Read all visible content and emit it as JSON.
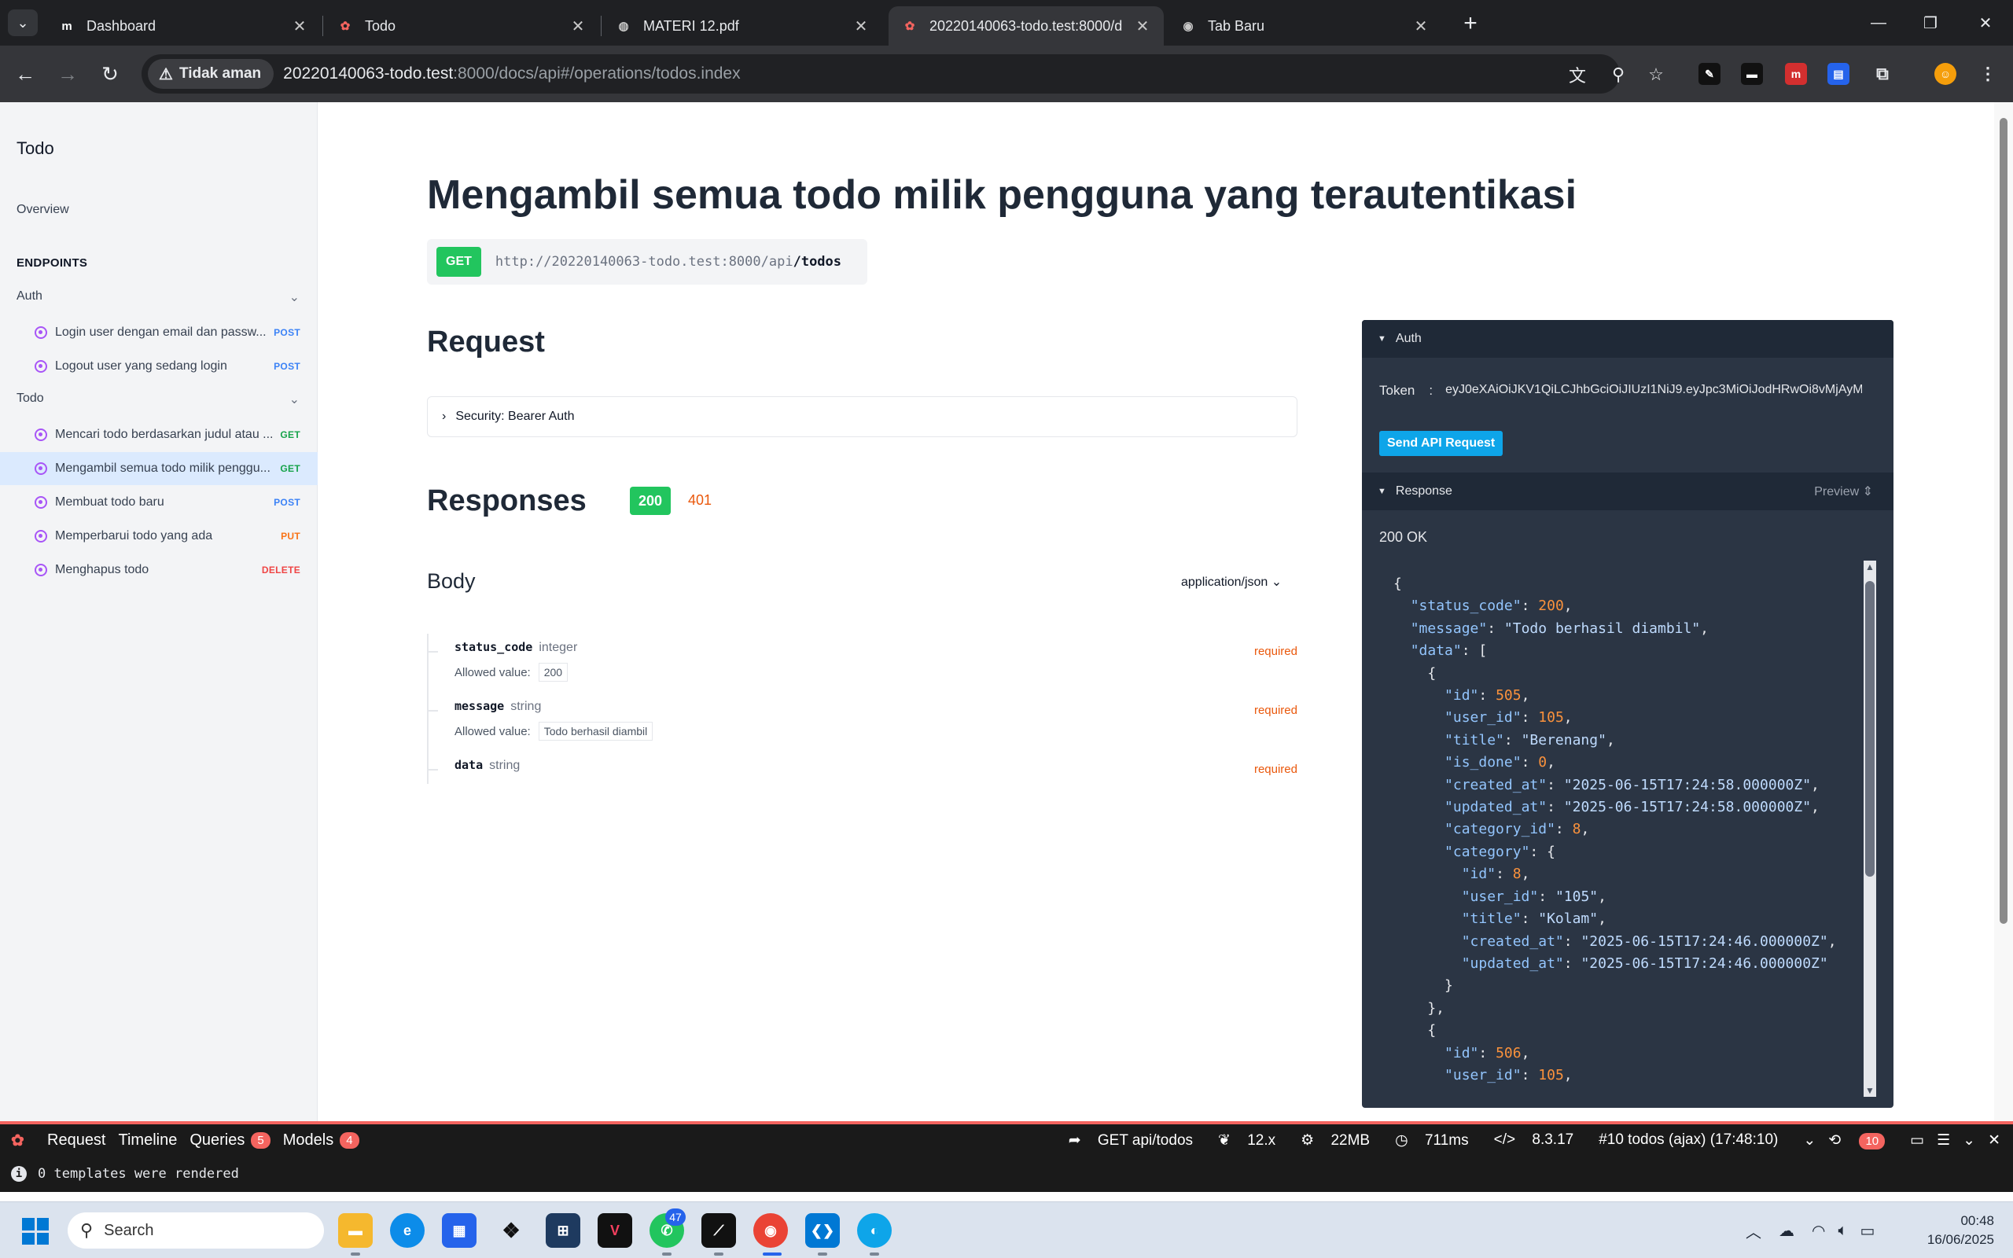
{
  "browser": {
    "tabs": [
      {
        "title": "Dashboard",
        "favicon": "m"
      },
      {
        "title": "Todo",
        "favicon": "laravel"
      },
      {
        "title": "MATERI 12.pdf",
        "favicon": "globe"
      },
      {
        "title": "20220140063-todo.test:8000/d",
        "favicon": "laravel"
      },
      {
        "title": "Tab Baru",
        "favicon": "chrome"
      }
    ],
    "security_label": "Tidak aman",
    "url_host": "20220140063-todo.test",
    "url_path": ":8000/docs/api#/operations/todos.index"
  },
  "sidebar": {
    "title": "Todo",
    "overview": "Overview",
    "endpoints_heading": "ENDPOINTS",
    "groups": [
      {
        "name": "Auth",
        "items": [
          {
            "label": "Login user dengan email dan passw...",
            "method": "POST"
          },
          {
            "label": "Logout user yang sedang login",
            "method": "POST"
          }
        ]
      },
      {
        "name": "Todo",
        "items": [
          {
            "label": "Mencari todo berdasarkan judul atau ...",
            "method": "GET"
          },
          {
            "label": "Mengambil semua todo milik penggu...",
            "method": "GET"
          },
          {
            "label": "Membuat todo baru",
            "method": "POST"
          },
          {
            "label": "Memperbarui todo yang ada",
            "method": "PUT"
          },
          {
            "label": "Menghapus todo",
            "method": "DELETE"
          }
        ]
      }
    ]
  },
  "main": {
    "title": "Mengambil semua todo milik pengguna yang terautentikasi",
    "method": "GET",
    "endpoint_base": "http://20220140063-todo.test:8000/api",
    "endpoint_path": "/todos",
    "request_heading": "Request",
    "security_label": "Security: Bearer Auth",
    "responses_heading": "Responses",
    "codes": [
      "200",
      "401"
    ],
    "body_heading": "Body",
    "content_type": "application/json",
    "fields": [
      {
        "name": "status_code",
        "type": "integer",
        "required": "required",
        "allowed_label": "Allowed value:",
        "allowed": "200"
      },
      {
        "name": "message",
        "type": "string",
        "required": "required",
        "allowed_label": "Allowed value:",
        "allowed": "Todo berhasil diambil"
      },
      {
        "name": "data",
        "type": "string",
        "required": "required"
      }
    ]
  },
  "tryit": {
    "auth_label": "Auth",
    "token_label": "Token",
    "token_sep": ":",
    "token_value": "eyJ0eXAiOiJKV1QiLCJhbGciOiJIUzI1NiJ9.eyJpc3MiOiJodHRwOi8vMjAyM",
    "send_label": "Send API Request",
    "response_label": "Response",
    "preview_label": "Preview",
    "status": "200 OK",
    "json_lines": [
      "{",
      "  \"status_code\": 200,",
      "  \"message\": \"Todo berhasil diambil\",",
      "  \"data\": [",
      "    {",
      "      \"id\": 505,",
      "      \"user_id\": 105,",
      "      \"title\": \"Berenang\",",
      "      \"is_done\": 0,",
      "      \"created_at\": \"2025-06-15T17:24:58.000000Z\",",
      "      \"updated_at\": \"2025-06-15T17:24:58.000000Z\",",
      "      \"category_id\": 8,",
      "      \"category\": {",
      "        \"id\": 8,",
      "        \"user_id\": \"105\",",
      "        \"title\": \"Kolam\",",
      "        \"created_at\": \"2025-06-15T17:24:46.000000Z\",",
      "        \"updated_at\": \"2025-06-15T17:24:46.000000Z\"",
      "      }",
      "    },",
      "    {",
      "      \"id\": 506,",
      "      \"user_id\": 105,"
    ]
  },
  "debugbar": {
    "tabs": [
      {
        "label": "Request"
      },
      {
        "label": "Timeline"
      },
      {
        "label": "Queries",
        "badge": "5"
      },
      {
        "label": "Models",
        "badge": "4"
      }
    ],
    "route": "GET api/todos",
    "laravel_version": "12.x",
    "memory": "22MB",
    "time": "711ms",
    "php_version": "8.3.17",
    "request_label": "#10 todos (ajax) (17:48:10)",
    "history_badge": "10",
    "message": "0 templates were rendered"
  },
  "taskbar": {
    "search_placeholder": "Search",
    "whatsapp_badge": "47",
    "time": "00:48",
    "date": "16/06/2025"
  }
}
